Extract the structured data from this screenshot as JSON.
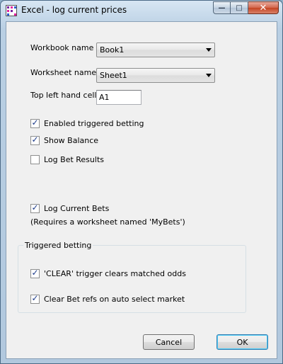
{
  "window": {
    "title": "Excel - log current prices",
    "controls": {
      "minimize": "—",
      "maximize": "□",
      "close": "✕"
    },
    "icon_colors": [
      "#7a1fa2",
      "#e01fa0",
      "#2f5fd0"
    ]
  },
  "form": {
    "workbook_label": "Workbook name",
    "workbook_value": "Book1",
    "worksheet_label": "Worksheet name",
    "worksheet_value": "Sheet1",
    "cell_label": "Top left hand cell",
    "cell_value": "A1"
  },
  "options": {
    "enabled_triggered": {
      "label": "Enabled triggered betting",
      "checked": true
    },
    "show_balance": {
      "label": "Show Balance",
      "checked": true
    },
    "log_bet_results": {
      "label": "Log Bet Results",
      "checked": false
    },
    "log_current_bets": {
      "label": "Log Current Bets",
      "checked": true
    },
    "log_current_bets_note": "(Requires a worksheet named 'MyBets')"
  },
  "triggered_group": {
    "title": "Triggered betting",
    "clear_trigger": {
      "label": "'CLEAR' trigger clears matched odds",
      "checked": true
    },
    "clear_bet_refs": {
      "label": "Clear Bet refs on auto select market",
      "checked": true
    }
  },
  "buttons": {
    "cancel": "Cancel",
    "ok": "OK"
  }
}
